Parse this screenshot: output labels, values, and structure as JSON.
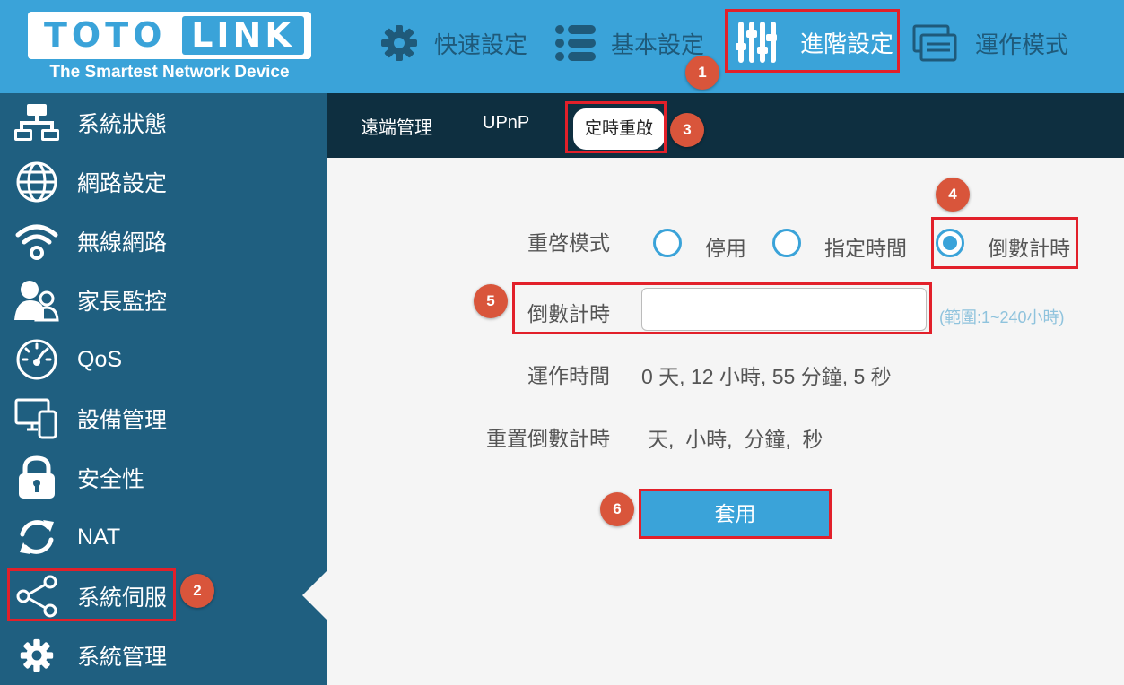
{
  "header": {
    "logo_left": "TOTO",
    "logo_right": "LINK",
    "tagline": "The Smartest Network Device",
    "nav": [
      {
        "label": "快速設定",
        "icon": "gear-icon"
      },
      {
        "label": "基本設定",
        "icon": "list-icon"
      },
      {
        "label": "進階設定",
        "icon": "sliders-icon",
        "active": true
      },
      {
        "label": "運作模式",
        "icon": "window-icon"
      }
    ]
  },
  "sidebar": {
    "items": [
      {
        "label": "系統狀態",
        "icon": "network-status-icon"
      },
      {
        "label": "網路設定",
        "icon": "globe-icon"
      },
      {
        "label": "無線網路",
        "icon": "wifi-icon"
      },
      {
        "label": "家長監控",
        "icon": "parental-control-icon"
      },
      {
        "label": "QoS",
        "icon": "speedometer-icon"
      },
      {
        "label": "設備管理",
        "icon": "devices-icon"
      },
      {
        "label": "安全性",
        "icon": "lock-icon"
      },
      {
        "label": "NAT",
        "icon": "refresh-icon"
      },
      {
        "label": "系統伺服",
        "icon": "share-icon",
        "active": true
      },
      {
        "label": "系統管理",
        "icon": "gear-icon"
      }
    ]
  },
  "subtabs": [
    {
      "label": "遠端管理"
    },
    {
      "label": "UPnP"
    },
    {
      "label": "定時重啟",
      "active": true
    }
  ],
  "form": {
    "reboot_mode_label": "重啓模式",
    "options": [
      {
        "label": "停用",
        "checked": false
      },
      {
        "label": "指定時間",
        "checked": false
      },
      {
        "label": "倒數計時",
        "checked": true
      }
    ],
    "countdown_label": "倒數計時",
    "countdown_value": "",
    "countdown_hint": "(範圍:1~240小時)",
    "uptime_label": "運作時間",
    "uptime_value": "0 天, 12 小時, 55 分鐘, 5 秒",
    "reset_label": "重置倒數計時",
    "reset_value": "天,  小時,  分鐘,  秒",
    "apply_label": "套用"
  },
  "annotations": [
    "1",
    "2",
    "3",
    "4",
    "5",
    "6"
  ],
  "colors": {
    "header_bg": "#3aa3d9",
    "sidebar_bg": "#1f5f80",
    "subtab_bg": "#0e2f40",
    "accent": "#3aa3d9",
    "annotation_red": "#e2202a",
    "badge": "#d9553b"
  }
}
